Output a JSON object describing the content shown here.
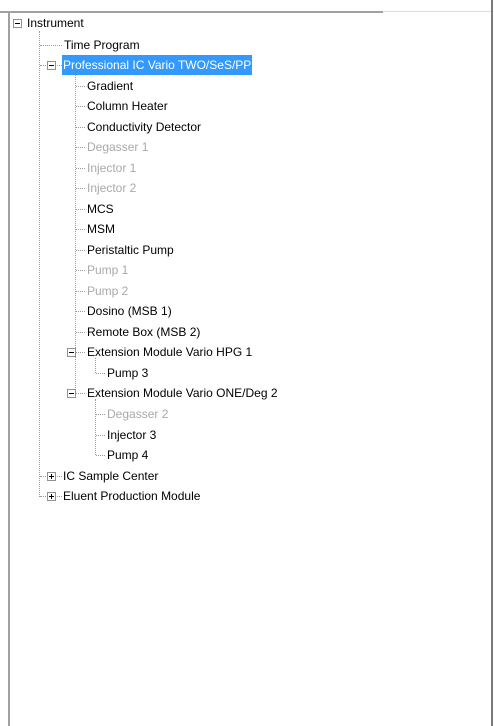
{
  "tree": {
    "root": {
      "label": "Instrument",
      "expanded": true
    },
    "time_program": {
      "label": "Time Program"
    },
    "professional": {
      "label": "Professional IC Vario TWO/SeS/PP",
      "expanded": true,
      "selected": true,
      "children": [
        {
          "label": "Gradient",
          "enabled": true
        },
        {
          "label": "Column Heater",
          "enabled": true
        },
        {
          "label": "Conductivity Detector",
          "enabled": true
        },
        {
          "label": "Degasser 1",
          "enabled": false
        },
        {
          "label": "Injector 1",
          "enabled": false
        },
        {
          "label": "Injector 2",
          "enabled": false
        },
        {
          "label": "MCS",
          "enabled": true
        },
        {
          "label": "MSM",
          "enabled": true
        },
        {
          "label": "Peristaltic Pump",
          "enabled": true
        },
        {
          "label": "Pump 1",
          "enabled": false
        },
        {
          "label": "Pump 2",
          "enabled": false
        },
        {
          "label": "Dosino (MSB 1)",
          "enabled": true
        },
        {
          "label": "Remote Box (MSB 2)",
          "enabled": true
        }
      ]
    },
    "ext_hpg": {
      "label": "Extension Module Vario HPG 1",
      "expanded": true,
      "children": [
        {
          "label": "Pump 3",
          "enabled": true
        }
      ]
    },
    "ext_one": {
      "label": "Extension Module Vario ONE/Deg 2",
      "expanded": true,
      "children": [
        {
          "label": "Degasser 2",
          "enabled": false
        },
        {
          "label": "Injector 3",
          "enabled": true
        },
        {
          "label": "Pump 4",
          "enabled": true
        }
      ]
    },
    "sample_center": {
      "label": "IC Sample Center",
      "expanded": false
    },
    "eluent": {
      "label": "Eluent Production Module",
      "expanded": false
    }
  },
  "colors": {
    "selection": "#3399ff",
    "disabled_text": "#a9a9a9",
    "text": "#000000"
  }
}
